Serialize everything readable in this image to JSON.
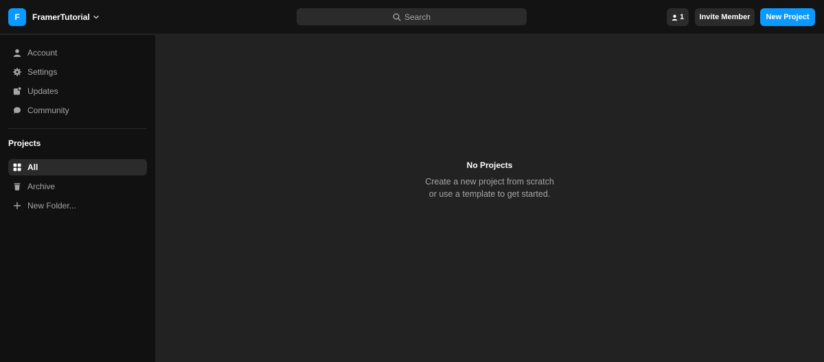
{
  "workspace": {
    "initial": "F",
    "name": "FramerTutorial"
  },
  "search": {
    "placeholder": "Search"
  },
  "header": {
    "members_count": "1",
    "invite_label": "Invite Member",
    "new_project_label": "New Project"
  },
  "sidebar": {
    "account_items": [
      {
        "label": "Account",
        "icon": "user-icon"
      },
      {
        "label": "Settings",
        "icon": "gear-icon"
      },
      {
        "label": "Updates",
        "icon": "updates-icon"
      },
      {
        "label": "Community",
        "icon": "chat-bubble-icon"
      }
    ],
    "projects_title": "Projects",
    "project_items": [
      {
        "label": "All",
        "icon": "grid-icon",
        "active": true
      },
      {
        "label": "Archive",
        "icon": "trash-icon"
      },
      {
        "label": "New Folder...",
        "icon": "plus-icon"
      }
    ]
  },
  "empty_state": {
    "title": "No Projects",
    "line1": "Create a new project from scratch",
    "line2": "or use a template to get started."
  },
  "colors": {
    "accent": "#0a99ff",
    "topbar_bg": "#131313",
    "sidebar_bg": "#111111",
    "main_bg": "#222222",
    "muted_text": "#a6a6a6"
  }
}
